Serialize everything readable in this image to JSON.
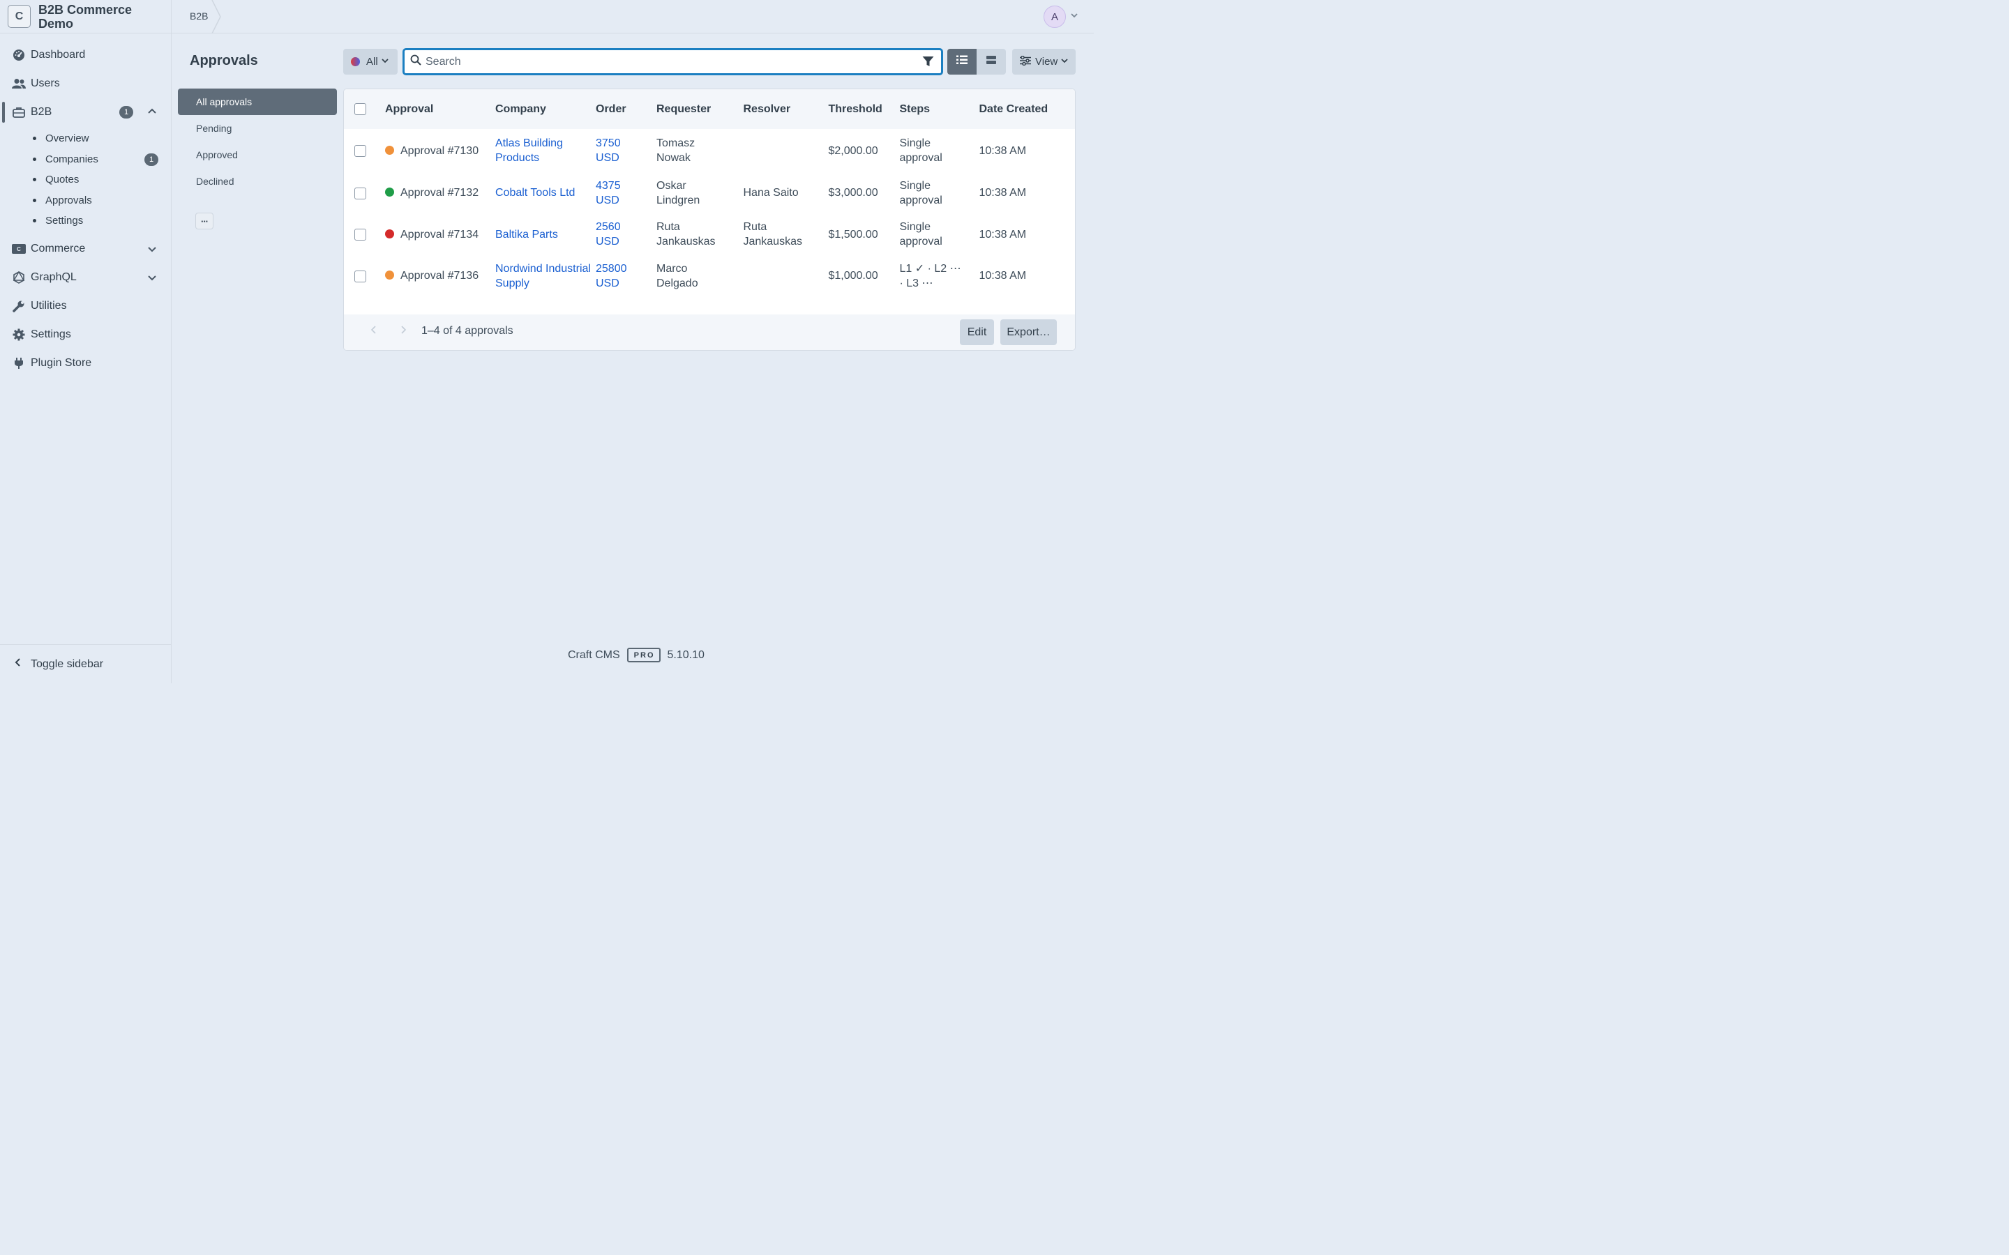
{
  "site": {
    "logo_letter": "C",
    "name": "B2B Commerce Demo"
  },
  "nav": {
    "dashboard": "Dashboard",
    "users": "Users",
    "b2b": {
      "label": "B2B",
      "badge": "1"
    },
    "subnav": {
      "overview": "Overview",
      "companies": {
        "label": "Companies",
        "badge": "1"
      },
      "quotes": "Quotes",
      "approvals": "Approvals",
      "settings": "Settings"
    },
    "commerce": "Commerce",
    "graphql": "GraphQL",
    "utilities": "Utilities",
    "settings": "Settings",
    "plugin_store": "Plugin Store",
    "toggle_sidebar": "Toggle sidebar"
  },
  "header": {
    "breadcrumb": "B2B",
    "avatar_letter": "A"
  },
  "page": {
    "title": "Approvals"
  },
  "sources": [
    "All approvals",
    "Pending",
    "Approved",
    "Declined"
  ],
  "toolbar": {
    "status": "All",
    "search_placeholder": "Search",
    "view_label": "View"
  },
  "table": {
    "headers": [
      "Approval",
      "Company",
      "Order",
      "Requester",
      "Resolver",
      "Threshold",
      "Steps",
      "Date Created"
    ],
    "rows": [
      {
        "status_color": "#f0913a",
        "approval": "Approval #7130",
        "company": "Atlas Building Products",
        "order": "3750 USD",
        "requester": "Tomasz Nowak",
        "resolver": "",
        "threshold": "$2,000.00",
        "steps": "Single approval",
        "date": "10:38 AM"
      },
      {
        "status_color": "#1f9d48",
        "approval": "Approval #7132",
        "company": "Cobalt Tools Ltd",
        "order": "4375 USD",
        "requester": "Oskar Lindgren",
        "resolver": "Hana Saito",
        "threshold": "$3,000.00",
        "steps": "Single approval",
        "date": "10:38 AM"
      },
      {
        "status_color": "#d42a2a",
        "approval": "Approval #7134",
        "company": "Baltika Parts",
        "order": "2560 USD",
        "requester": "Ruta Jankauskas",
        "resolver": "Ruta Jankauskas",
        "threshold": "$1,500.00",
        "steps": "Single approval",
        "date": "10:38 AM"
      },
      {
        "status_color": "#f0913a",
        "approval": "Approval #7136",
        "company": "Nordwind Industrial Supply",
        "order": "25800 USD",
        "requester": "Marco Delgado",
        "resolver": "",
        "threshold": "$1,000.00",
        "steps": "L1 ✓ · L2 ⋯ · L3 ⋯",
        "date": "10:38 AM"
      }
    ],
    "count": "1–4 of 4 approvals",
    "edit": "Edit",
    "export": "Export…"
  },
  "app_info": {
    "name": "Craft CMS",
    "edition": "PRO",
    "version": "5.10.10"
  }
}
